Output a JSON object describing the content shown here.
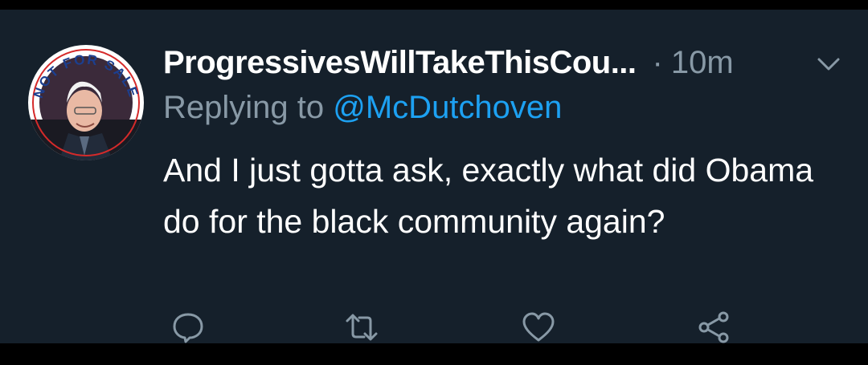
{
  "tweet": {
    "display_name": "ProgressivesWillTakeThisCou...",
    "separator": "·",
    "time": "10m",
    "reply_prefix": "Replying to",
    "reply_handle": "@McDutchoven",
    "text": "And I just gotta ask, exactly what did Obama do for the black community again?",
    "avatar_ring_text": "NOT FOR SALE"
  },
  "colors": {
    "background": "#15202b",
    "name": "#ffffff",
    "muted": "#8899a6",
    "link": "#1da1f2"
  },
  "icons": {
    "more": "chevron-down-icon",
    "reply": "reply-bubble-icon",
    "retweet": "retweet-icon",
    "like": "heart-icon",
    "share": "share-icon"
  }
}
